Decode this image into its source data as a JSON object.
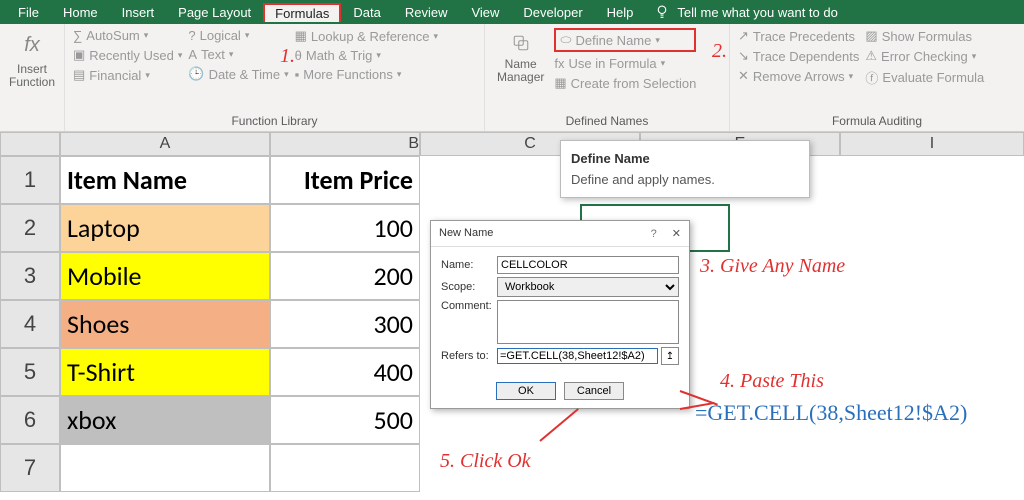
{
  "tabs": [
    "File",
    "Home",
    "Insert",
    "Page Layout",
    "Formulas",
    "Data",
    "Review",
    "View",
    "Developer",
    "Help"
  ],
  "active_tab_index": 4,
  "tell_me": "Tell me what you want to do",
  "ribbon": {
    "insert_function": "Insert Function",
    "library": {
      "autosum": "AutoSum",
      "recent": "Recently Used",
      "financial": "Financial",
      "logical": "Logical",
      "text": "Text",
      "datetime": "Date & Time",
      "lookup": "Lookup & Reference",
      "math": "Math & Trig",
      "more": "More Functions",
      "group_label": "Function Library"
    },
    "defined": {
      "name_manager": "Name Manager",
      "define_name": "Define Name",
      "use_in_formula": "Use in Formula",
      "create_selection": "Create from Selection",
      "group_label": "Defined Names"
    },
    "auditing": {
      "trace_precedents": "Trace Precedents",
      "trace_dependents": "Trace Dependents",
      "remove_arrows": "Remove Arrows",
      "show_formulas": "Show Formulas",
      "error_checking": "Error Checking",
      "evaluate_formula": "Evaluate Formula",
      "group_label": "Formula Auditing"
    }
  },
  "tooltip": {
    "title": "Define Name",
    "body": "Define and apply names."
  },
  "columns": [
    "A",
    "B",
    "C",
    "E",
    "I"
  ],
  "table": {
    "headers": [
      "Item Name",
      "Item Price"
    ],
    "rows": [
      {
        "n": "1"
      },
      {
        "n": "2",
        "a": "Laptop",
        "b": "100",
        "color": "#fcd49a"
      },
      {
        "n": "3",
        "a": "Mobile",
        "b": "200",
        "color": "#ffff00"
      },
      {
        "n": "4",
        "a": "Shoes",
        "b": "300",
        "color": "#f4b084"
      },
      {
        "n": "5",
        "a": "T-Shirt",
        "b": "400",
        "color": "#ffff00"
      },
      {
        "n": "6",
        "a": "xbox",
        "b": "500",
        "color": "#bfbfbf"
      },
      {
        "n": "7"
      }
    ]
  },
  "dialog": {
    "title": "New Name",
    "name_label": "Name:",
    "name_value": "CELLCOLOR",
    "scope_label": "Scope:",
    "scope_value": "Workbook",
    "comment_label": "Comment:",
    "refers_label": "Refers to:",
    "refers_value": "=GET.CELL(38,Sheet12!$A2)",
    "ok": "OK",
    "cancel": "Cancel"
  },
  "annotations": {
    "a1": "1.",
    "a2": "2.",
    "a3": "3. Give Any Name",
    "a4": "4. Paste This",
    "a5": "5. Click Ok",
    "formula": "=GET.CELL(38,Sheet12!$A2)"
  }
}
